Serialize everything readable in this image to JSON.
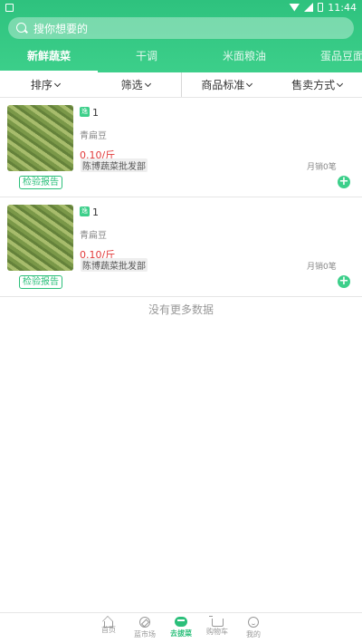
{
  "status_bar": {
    "time": "11:44"
  },
  "search": {
    "placeholder": "搜你想要的"
  },
  "tabs": [
    {
      "label": "新鲜蔬菜",
      "active": true
    },
    {
      "label": "干调",
      "active": false
    },
    {
      "label": "米面粮油",
      "active": false
    },
    {
      "label": "蛋品豆面",
      "active": false
    }
  ],
  "filters": [
    {
      "label": "排序"
    },
    {
      "label": "筛选"
    },
    {
      "label": "商品标准"
    },
    {
      "label": "售卖方式"
    }
  ],
  "products": [
    {
      "badge": "逸",
      "number": "1",
      "name": "青扁豆",
      "price": "0.10/斤",
      "seller": "陈博蔬菜批发部",
      "sales": "月销0笔",
      "report_label": "检验报告",
      "add_icon": "plus-circle-icon"
    },
    {
      "badge": "逸",
      "number": "1",
      "name": "青扁豆",
      "price": "0.10/斤",
      "seller": "陈博蔬菜批发部",
      "sales": "月销0笔",
      "report_label": "检验报告",
      "add_icon": "plus-circle-icon"
    }
  ],
  "no_more_text": "没有更多数据",
  "bottom_nav": [
    {
      "label": "首页",
      "icon": "home-icon",
      "active": false
    },
    {
      "label": "蓝市场",
      "icon": "compass-icon",
      "active": false
    },
    {
      "label": "去拔菜",
      "icon": "basket-icon",
      "active": true
    },
    {
      "label": "购物车",
      "icon": "cart-icon",
      "active": false
    },
    {
      "label": "我的",
      "icon": "profile-icon",
      "active": false
    }
  ],
  "colors": {
    "brand": "#3ccf8a",
    "price": "#e23c3c"
  }
}
